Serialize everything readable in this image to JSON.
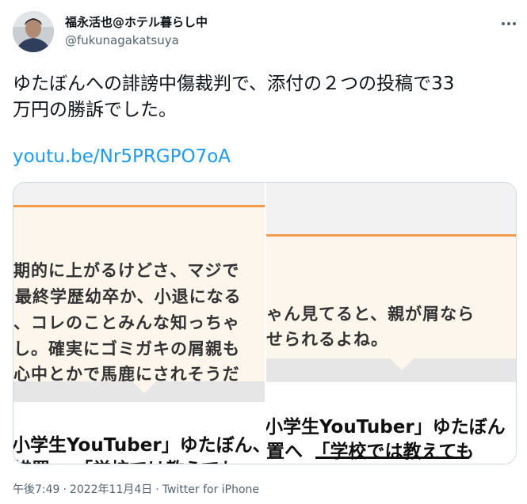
{
  "author": {
    "name": "福永活也@ホテル暮らし中",
    "handle": "@fukunagakatsuya"
  },
  "tweet": {
    "text": "ゆたぼんへの誹謗中傷裁判で、添付の２つの投稿で33\n万円の勝訴でした。",
    "link": "youtu.be/Nr5PRGPO7oA"
  },
  "media": {
    "left": {
      "lines": [
        "期的に上がるけどさ、マジで",
        "最終学歴幼卒か、小退になる",
        "、コレのことみんな知っちゃ",
        "し。確実にゴミガキの屑親も",
        "心中とかで馬鹿にされそうだ"
      ],
      "headline_1": "小学生YouTuber」ゆたぼん、",
      "headline_2": "措置へ 「学校では教えても"
    },
    "right": {
      "lines": [
        "ゃん見てると、親が屑なら",
        "せられるよね。"
      ],
      "headline_1": "小学生YouTuber」ゆたぼん",
      "headline_2": "置へ　「学校では教えても"
    }
  },
  "meta": {
    "time": "午後7:49",
    "date": "2022年11月4日",
    "source": "Twitter for iPhone"
  },
  "colors": {
    "link": "#1d9bf0",
    "secondary_text": "#536471",
    "accent_orange": "#f29a4a"
  }
}
